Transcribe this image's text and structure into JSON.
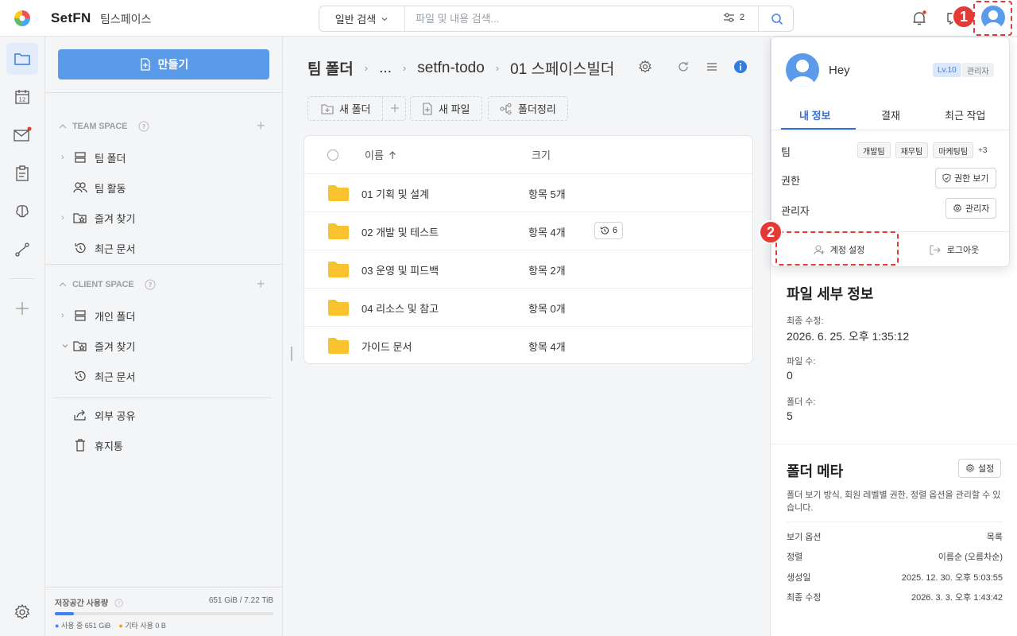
{
  "app": {
    "brand": "SetFN",
    "workspace": "팀스페이스"
  },
  "search": {
    "mode": "일반 검색",
    "placeholder": "파일 및 내용 검색...",
    "filter_count": "2"
  },
  "annotations": {
    "step1": "1",
    "step2": "2"
  },
  "sidebar": {
    "create_label": "만들기",
    "team_space": {
      "title": "TEAM SPACE",
      "items": [
        {
          "label": "팀 폴더",
          "icon": "server-icon"
        },
        {
          "label": "팀 활동",
          "icon": "users-icon"
        },
        {
          "label": "즐겨 찾기",
          "icon": "star-folder-icon"
        },
        {
          "label": "최근 문서",
          "icon": "history-icon"
        }
      ]
    },
    "client_space": {
      "title": "CLIENT SPACE",
      "items": [
        {
          "label": "개인 폴더",
          "icon": "server-icon"
        },
        {
          "label": "즐겨 찾기",
          "icon": "star-folder-icon"
        },
        {
          "label": "최근 문서",
          "icon": "history-icon"
        }
      ]
    },
    "extra": [
      {
        "label": "외부 공유",
        "icon": "share-icon"
      },
      {
        "label": "휴지통",
        "icon": "trash-icon"
      }
    ],
    "storage": {
      "label": "저장공간 사용량",
      "value": "651 GiB / 7.22 TiB",
      "used_fraction": 0.088,
      "legend_used": "사용 중 651 GiB",
      "legend_other": "기타 사용 0 B"
    }
  },
  "main": {
    "breadcrumb": [
      "팀 폴더",
      "...",
      "setfn-todo",
      "01 스페이스빌더"
    ],
    "toolbar": {
      "new_folder": "새 폴더",
      "new_file": "새 파일",
      "organize": "폴더정리"
    },
    "table": {
      "col_name": "이름",
      "col_size": "크기",
      "rows": [
        {
          "name": "01 기획 및 설계",
          "size": "항목 5개",
          "history": ""
        },
        {
          "name": "02 개발 및 테스트",
          "size": "항목 4개",
          "history": "6"
        },
        {
          "name": "03 운영 및 피드백",
          "size": "항목 2개",
          "history": ""
        },
        {
          "name": "04 리소스 및 참고",
          "size": "항목 0개",
          "history": ""
        },
        {
          "name": "가이드 문서",
          "size": "항목 4개",
          "history": ""
        }
      ]
    }
  },
  "popup": {
    "name": "Hey",
    "level": "Lv.10",
    "role": "관리자",
    "tabs": [
      "내 정보",
      "결재",
      "최근 작업"
    ],
    "team_label": "팀",
    "teams": [
      "개발팀",
      "재무팀",
      "마케팅팀"
    ],
    "teams_more": "+3",
    "perm_label": "권한",
    "perm_btn": "권한 보기",
    "admin_label": "관리자",
    "admin_btn": "관리자",
    "account_settings": "계정 설정",
    "logout": "로그아웃"
  },
  "details": {
    "title": "파일 세부 정보",
    "modified_label": "최종 수정:",
    "modified_value": "2026. 6. 25. 오후 1:35:12",
    "files_label": "파일 수:",
    "files_value": "0",
    "folders_label": "폴더 수:",
    "folders_value": "5"
  },
  "folder_meta": {
    "title": "폴더 메타",
    "settings_btn": "설정",
    "desc": "폴더 보기 방식, 회원 레벨별 권한, 정렬 옵션을 관리할 수 있습니다.",
    "rows": [
      {
        "label": "보기 옵션",
        "value": "목록"
      },
      {
        "label": "정렬",
        "value": "이름순 (오름차순)"
      },
      {
        "label": "생성일",
        "value": "2025. 12. 30. 오후 5:03:55"
      },
      {
        "label": "최종 수정",
        "value": "2026. 3. 3. 오후 1:43:42"
      }
    ]
  },
  "colors": {
    "accent": "#5a9be9",
    "folder": "#f9c22e",
    "annotation": "#e53935"
  }
}
